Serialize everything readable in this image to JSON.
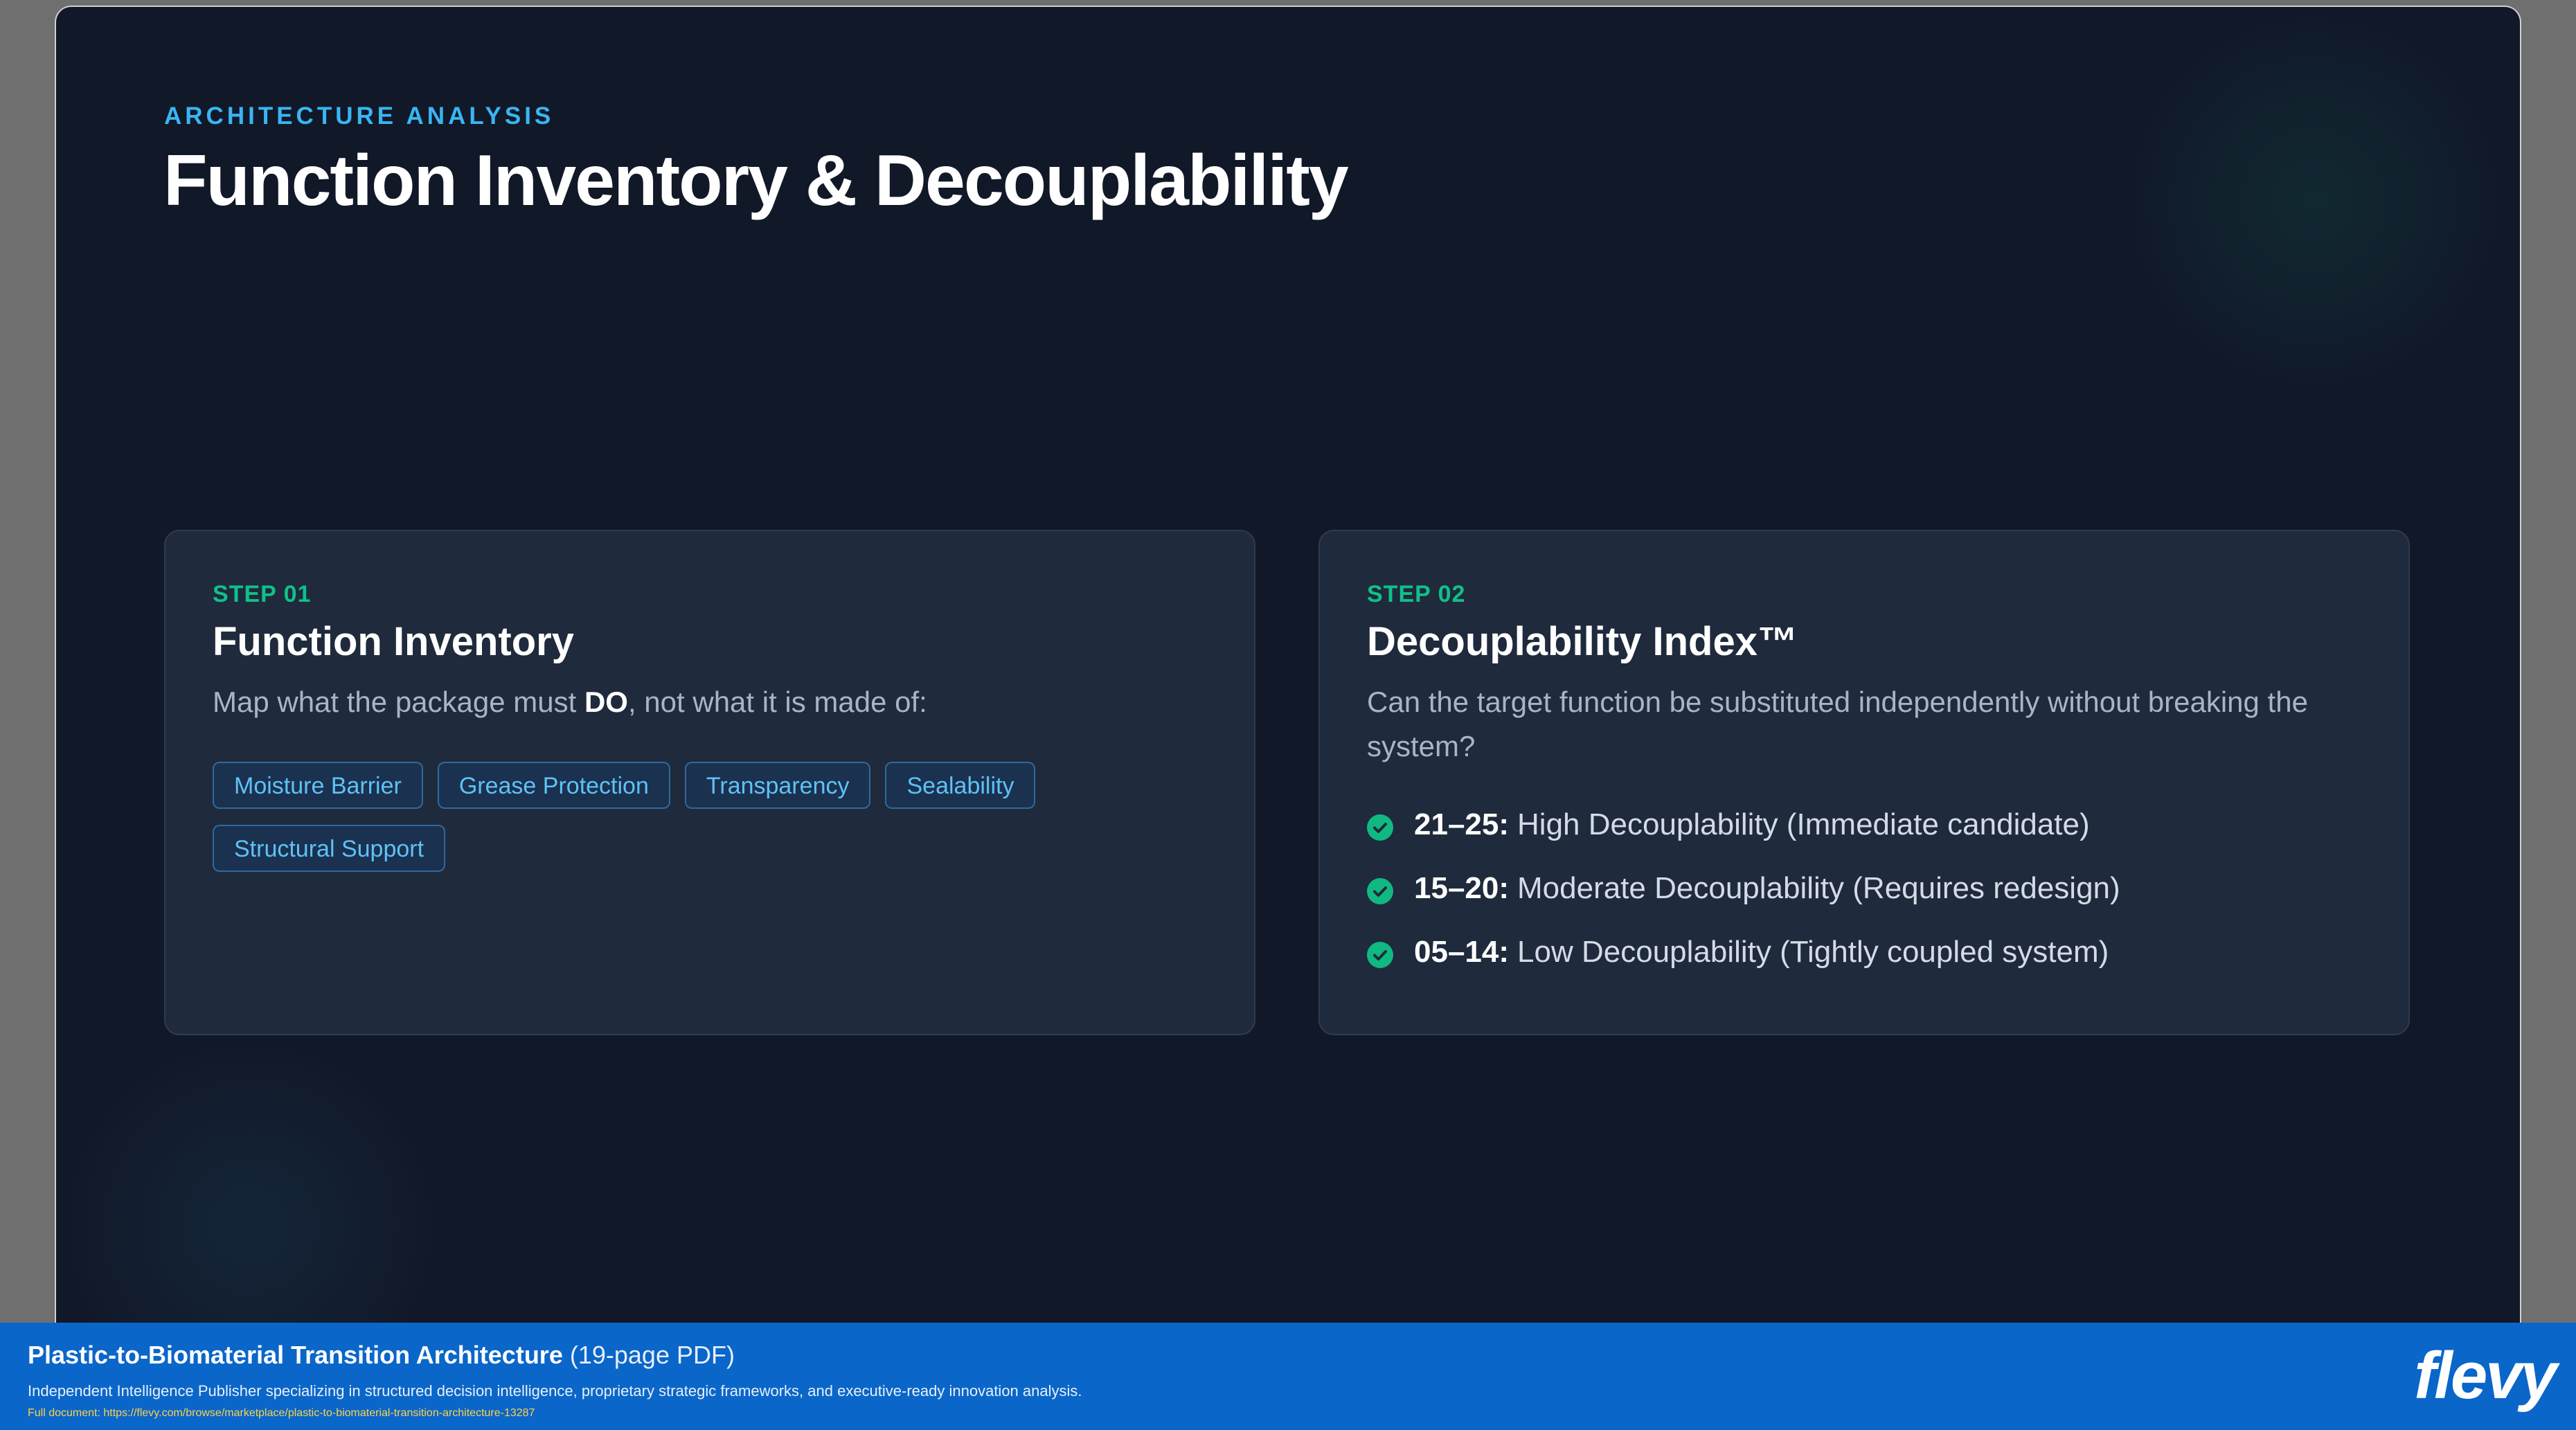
{
  "slide": {
    "eyebrow": "ARCHITECTURE ANALYSIS",
    "title": "Function Inventory & Decouplability"
  },
  "step1": {
    "step_label": "STEP 01",
    "title": "Function Inventory",
    "desc_before": "Map what the package must ",
    "desc_bold": "DO",
    "desc_after": ", not what it is made of:",
    "tags": [
      "Moisture Barrier",
      "Grease Protection",
      "Transparency",
      "Sealability",
      "Structural Support"
    ]
  },
  "step2": {
    "step_label": "STEP 02",
    "title": "Decouplability Index™",
    "desc": "Can the target function be substituted independently without breaking the system?",
    "items": [
      {
        "key": "21–25:",
        "text": "High Decouplability (Immediate candidate)",
        "icon": "check-circle-icon"
      },
      {
        "key": "15–20:",
        "text": "Moderate Decouplability (Requires redesign)",
        "icon": "check-circle-icon"
      },
      {
        "key": "05–14:",
        "text": "Low Decouplability (Tightly coupled system)",
        "icon": "check-circle-icon"
      }
    ]
  },
  "footer": {
    "title": "Plastic-to-Biomaterial Transition Architecture",
    "subtitle": "(19-page PDF)",
    "description": "Independent Intelligence Publisher specializing in structured decision intelligence, proprietary strategic frameworks, and executive-ready innovation analysis.",
    "link": "Full document: https://flevy.com/browse/marketplace/plastic-to-biomaterial-transition-architecture-13287",
    "logo": "flevy"
  },
  "colors": {
    "background": "#111828",
    "card": "#1f2a3c",
    "accent_blue": "#38b6f2",
    "accent_green": "#10c08a",
    "footer": "#0a66c9"
  }
}
